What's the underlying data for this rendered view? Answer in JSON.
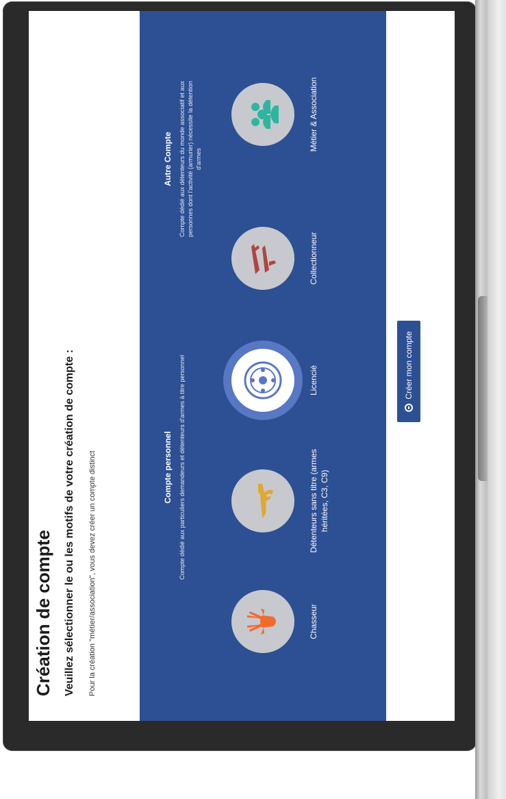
{
  "page": {
    "title": "Création de compte",
    "subtitle": "Veuillez sélectionner le ou les motifs de votre création de compte :",
    "note": "Pour la création \"métier/association\", vous devez créer un compte distinct"
  },
  "groups": {
    "personal": {
      "title": "Compte personnel",
      "description": "Compte dédié aux particuliers demandeurs et détenteurs d'armes à titre personnel"
    },
    "other": {
      "title": "Autre Compte",
      "description": "Compte dédié aux détenteurs du monde associatif et aux personnes dont l'activité (armurier) nécessite la détention d'armes"
    }
  },
  "options": [
    {
      "label": "Chasseur",
      "icon": "deer-head-icon",
      "icon_color": "#f26b2d",
      "selected": false
    },
    {
      "label": "Détenteurs sans titre (armes héritées, C3, C9)",
      "icon": "rifle-icon",
      "icon_color": "#e0a82e",
      "selected": false
    },
    {
      "label": "Licencié",
      "icon": "shooting-target-icon",
      "icon_color": "#5877c4",
      "selected": true
    },
    {
      "label": "Collectionneur",
      "icon": "antique-weapons-icon",
      "icon_color": "#b0453f",
      "selected": false
    },
    {
      "label": "Métier & Association",
      "icon": "people-group-icon",
      "icon_color": "#2eb5a0",
      "selected": false
    }
  ],
  "actions": {
    "submit_label": "Créer mon compte"
  },
  "colors": {
    "panel_background": "#2d4f93",
    "accent": "#5877c4"
  }
}
